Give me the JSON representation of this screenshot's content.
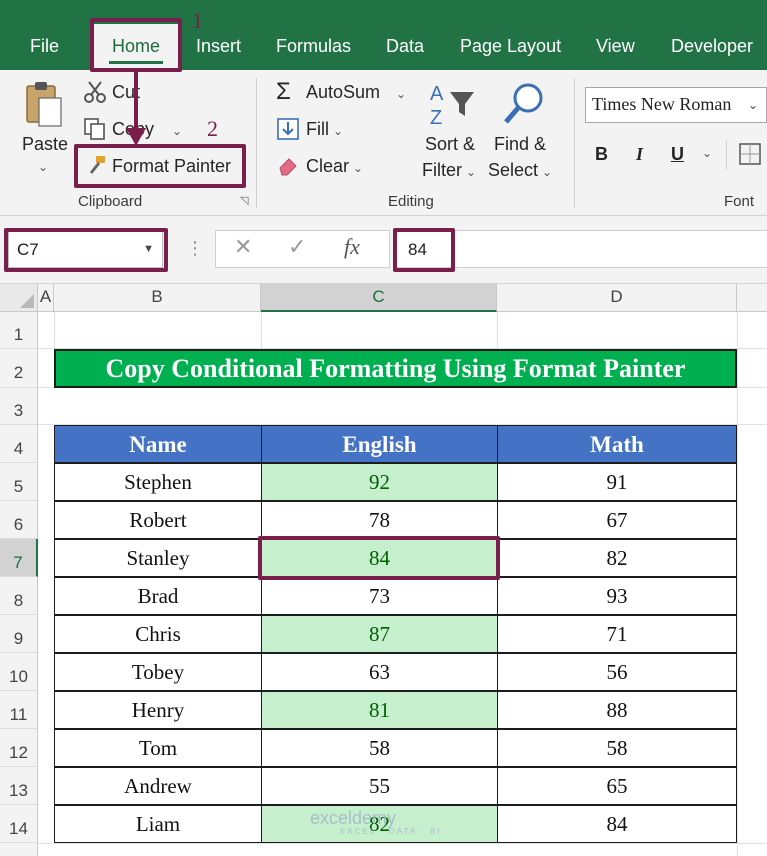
{
  "ribbon_tabs": [
    {
      "label": "File"
    },
    {
      "label": "Home"
    },
    {
      "label": "Insert"
    },
    {
      "label": "Formulas"
    },
    {
      "label": "Data"
    },
    {
      "label": "Page Layout"
    },
    {
      "label": "View"
    },
    {
      "label": "Developer"
    }
  ],
  "clipboard": {
    "paste": "Paste",
    "cut": "Cut",
    "copy": "Copy",
    "format_painter": "Format Painter",
    "group_label": "Clipboard"
  },
  "editing": {
    "autosum": "AutoSum",
    "fill": "Fill",
    "clear": "Clear",
    "sort_filter_1": "Sort &",
    "sort_filter_2": "Filter",
    "find_select_1": "Find &",
    "find_select_2": "Select",
    "group_label": "Editing"
  },
  "font": {
    "font_name": "Times New Roman",
    "bold": "B",
    "italic": "I",
    "underline": "U",
    "group_label": "Font"
  },
  "formula_bar": {
    "name_box": "C7",
    "value": "84"
  },
  "columns": [
    "A",
    "B",
    "C",
    "D"
  ],
  "rows": [
    "1",
    "2",
    "3",
    "4",
    "5",
    "6",
    "7",
    "8",
    "9",
    "10",
    "11",
    "12",
    "13",
    "14"
  ],
  "sheet": {
    "title": "Copy Conditional Formatting Using Format Painter",
    "headers": [
      "Name",
      "English",
      "Math"
    ],
    "data": [
      {
        "name": "Stephen",
        "english": "92",
        "math": "91"
      },
      {
        "name": "Robert",
        "english": "78",
        "math": "67"
      },
      {
        "name": "Stanley",
        "english": "84",
        "math": "82"
      },
      {
        "name": "Brad",
        "english": "73",
        "math": "93"
      },
      {
        "name": "Chris",
        "english": "87",
        "math": "71"
      },
      {
        "name": "Tobey",
        "english": "63",
        "math": "56"
      },
      {
        "name": "Henry",
        "english": "81",
        "math": "88"
      },
      {
        "name": "Tom",
        "english": "58",
        "math": "58"
      },
      {
        "name": "Andrew",
        "english": "55",
        "math": "65"
      },
      {
        "name": "Liam",
        "english": "82",
        "math": "84"
      }
    ]
  },
  "annotations": {
    "step1": "1",
    "step2": "2",
    "color": "#7a1f4b"
  },
  "colors": {
    "excel_green": "#217346",
    "title_fill": "#00b050",
    "header_fill": "#4472c4",
    "highlight_fill": "#c6efce",
    "highlight_text": "#006100"
  },
  "icons": [
    "paste-icon",
    "scissors-icon",
    "copy-icon",
    "paintbrush-icon",
    "sigma-icon",
    "fill-down-icon",
    "eraser-icon",
    "sort-filter-icon",
    "magnifier-icon",
    "borders-icon",
    "cancel-icon",
    "enter-icon",
    "function-icon"
  ],
  "watermark": {
    "brand": "exceldemy",
    "tagline": "EXCEL · DATA · BI"
  }
}
